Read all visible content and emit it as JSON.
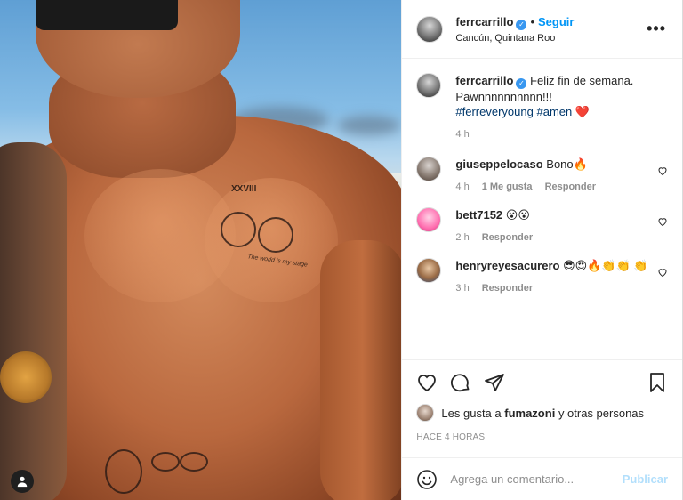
{
  "post": {
    "author": "ferrcarrillo",
    "follow_label": "Seguir",
    "dot": "•",
    "location": "Cancún, Quintana Roo",
    "more_label": "•••"
  },
  "caption": {
    "username": "ferrcarrillo",
    "text": "Feliz fin de semana. Pawnnnnnnnnnn!!!",
    "hashtag1": "#ferreveryoung",
    "hashtag2": "#amen",
    "emoji": "❤️",
    "time": "4 h"
  },
  "comments": [
    {
      "username": "giuseppelocaso",
      "text": "Bono🔥",
      "time": "4 h",
      "likes": "1 Me gusta",
      "reply": "Responder"
    },
    {
      "username": "bett7152",
      "text": "😮😮",
      "time": "2 h",
      "reply": "Responder"
    },
    {
      "username": "henryreyesacurero",
      "text": "😎😍🔥👏👏 👏",
      "time": "3 h",
      "reply": "Responder"
    }
  ],
  "likes": {
    "prefix": "Les gusta a",
    "user": "fumazoni",
    "suffix": "y otras personas"
  },
  "timestamp": "HACE 4 HORAS",
  "add_comment": {
    "placeholder": "Agrega un comentario...",
    "publish": "Publicar"
  },
  "photo_tattoos": {
    "roman": "XXVIII",
    "script": "The world is my stage"
  },
  "colors": {
    "accent": "#0095f6",
    "verified": "#3897f0",
    "publish_disabled": "#b2dffc",
    "hashtag": "#00376b"
  }
}
